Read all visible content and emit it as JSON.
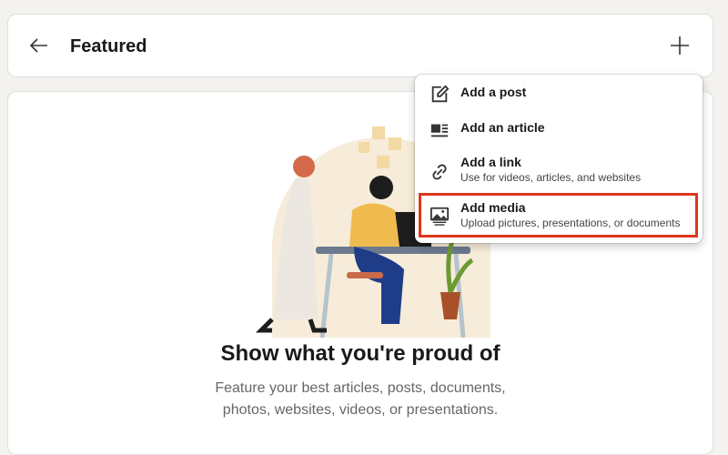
{
  "header": {
    "title": "Featured",
    "back_icon": "arrow-left-icon",
    "add_icon": "plus-icon"
  },
  "empty_state": {
    "headline": "Show what you're proud of",
    "description_line1": "Feature your best articles, posts, documents,",
    "description_line2": "photos, websites, videos, or presentations."
  },
  "menu": {
    "items": [
      {
        "label": "Add a post",
        "icon": "compose-icon"
      },
      {
        "label": "Add an article",
        "icon": "article-icon"
      },
      {
        "label": "Add a link",
        "sublabel": "Use for videos, articles, and websites",
        "icon": "link-icon"
      },
      {
        "label": "Add media",
        "sublabel": "Upload pictures, presentations, or documents",
        "icon": "image-icon",
        "highlighted": true
      }
    ]
  },
  "colors": {
    "highlight": "#e0361c",
    "background": "#f4f2ee"
  }
}
